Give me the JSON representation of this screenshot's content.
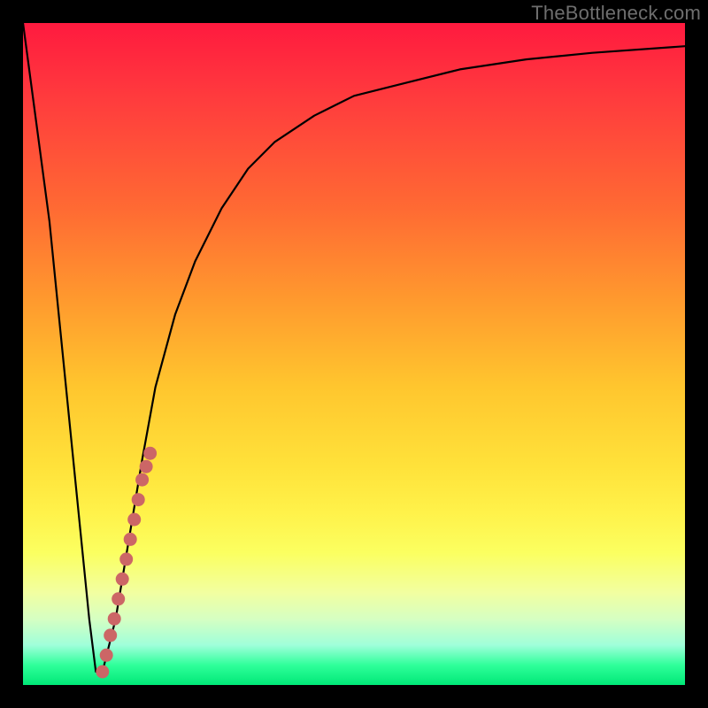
{
  "watermark": "TheBottleneck.com",
  "chart_data": {
    "type": "line",
    "title": "",
    "xlabel": "",
    "ylabel": "",
    "xlim": [
      0,
      100
    ],
    "ylim": [
      0,
      100
    ],
    "grid": false,
    "legend": false,
    "series": [
      {
        "name": "bottleneck-curve",
        "x": [
          0,
          4,
          8,
          10,
          11,
          12,
          14,
          16,
          18,
          20,
          23,
          26,
          30,
          34,
          38,
          44,
          50,
          58,
          66,
          76,
          86,
          100
        ],
        "y": [
          100,
          70,
          30,
          10,
          2,
          2,
          10,
          22,
          34,
          45,
          56,
          64,
          72,
          78,
          82,
          86,
          89,
          91,
          93,
          94.5,
          95.5,
          96.5
        ]
      }
    ],
    "markers": {
      "name": "highlighted-segment",
      "x": [
        12.0,
        12.6,
        13.2,
        13.8,
        14.4,
        15.0,
        15.6,
        16.2,
        16.8,
        17.4,
        18.0,
        18.6,
        19.2
      ],
      "y": [
        2.0,
        4.5,
        7.5,
        10.0,
        13.0,
        16.0,
        19.0,
        22.0,
        25.0,
        28.0,
        31.0,
        33.0,
        35.0
      ]
    },
    "colors": {
      "curve": "#000000",
      "marker": "#cc6666",
      "gradient_top": "#ff1a3f",
      "gradient_bottom": "#00e877"
    }
  }
}
